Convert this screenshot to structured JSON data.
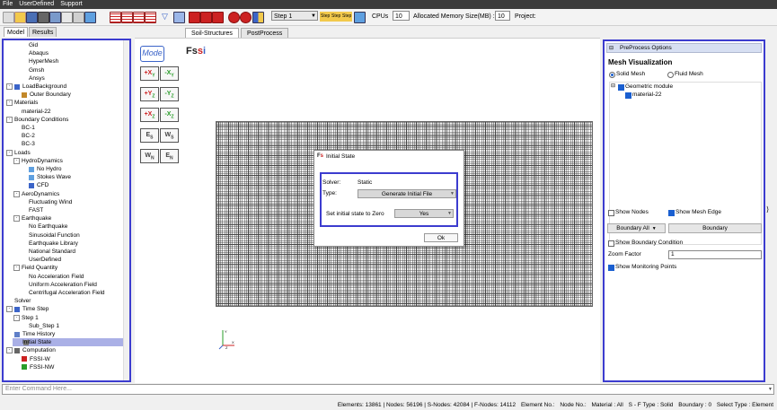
{
  "menu": [
    "File",
    "UserDefined",
    "Support"
  ],
  "toolbar": {
    "step_select": "Step 1",
    "step_buttons": [
      "Step",
      "Step",
      "Step"
    ],
    "cpus_label": "CPUs",
    "cpus_value": "10",
    "memory_label": "Allocated Memory Size(MB) :",
    "memory_value": "10",
    "project_label": "Project:"
  },
  "left_tabs": [
    "Model",
    "Results"
  ],
  "tree": [
    {
      "label": "Gid",
      "level": 2
    },
    {
      "label": "Abaqus",
      "level": 2
    },
    {
      "label": "HyperMesh",
      "level": 2
    },
    {
      "label": "Gmsh",
      "level": 2
    },
    {
      "label": "Ansys",
      "level": 2
    },
    {
      "label": "LoadBackground",
      "level": 0,
      "expander": "⊟",
      "icon": "load-icon"
    },
    {
      "label": "Outer Boundary",
      "level": 1,
      "icon": "boundary-icon"
    },
    {
      "label": "Materials",
      "level": 0,
      "expander": "⊟"
    },
    {
      "label": "material-22",
      "level": 1
    },
    {
      "label": "Boundary Conditions",
      "level": 0,
      "expander": "⊟"
    },
    {
      "label": "BC-1",
      "level": 1
    },
    {
      "label": "BC-2",
      "level": 1
    },
    {
      "label": "BC-3",
      "level": 1
    },
    {
      "label": "Loads",
      "level": 0,
      "expander": "⊟"
    },
    {
      "label": "HydroDynamics",
      "level": 1,
      "expander": "⊟"
    },
    {
      "label": "No Hydro",
      "level": 2,
      "icon": "hydro-icon"
    },
    {
      "label": "Stokes Wave",
      "level": 2,
      "icon": "wave-icon"
    },
    {
      "label": "CFD",
      "level": 2,
      "icon": "cfd-icon"
    },
    {
      "label": "AeroDynamics",
      "level": 1,
      "expander": "⊟"
    },
    {
      "label": "Fluctuating Wind",
      "level": 2
    },
    {
      "label": "FAST",
      "level": 2
    },
    {
      "label": "Earthquake",
      "level": 1,
      "expander": "⊟"
    },
    {
      "label": "No Earthquake",
      "level": 2
    },
    {
      "label": "Sinusoidal Function",
      "level": 2
    },
    {
      "label": "Earthquake Library",
      "level": 2
    },
    {
      "label": "National Standard",
      "level": 2
    },
    {
      "label": "UserDefined",
      "level": 2
    },
    {
      "label": "Field Quantity",
      "level": 1,
      "expander": "⊟"
    },
    {
      "label": "No Acceleration Field",
      "level": 2
    },
    {
      "label": "Uniform Acceleration Field",
      "level": 2
    },
    {
      "label": "Centrifugal Acceleration Field",
      "level": 2
    },
    {
      "label": "Solver",
      "level": 0
    },
    {
      "label": "Time Step",
      "level": 0,
      "expander": "⊟",
      "icon": "clock-icon"
    },
    {
      "label": "Step 1",
      "level": 1,
      "expander": "⊟"
    },
    {
      "label": "Sub_Step 1",
      "level": 2
    },
    {
      "label": "Time History",
      "level": 0,
      "icon": "history-icon"
    },
    {
      "label": "Initial State",
      "level": 0,
      "icon": "initial-state-icon",
      "selected": true
    },
    {
      "label": "Computation",
      "level": 0,
      "expander": "⊟",
      "icon": "computation-icon"
    },
    {
      "label": "FSSI-W",
      "level": 1,
      "icon": "flask-red-icon"
    },
    {
      "label": "FSSI-NW",
      "level": 1,
      "icon": "flask-green-icon"
    }
  ],
  "center_tabs": [
    "Soil-Structures",
    "PostProcess"
  ],
  "mode_button": "Mode",
  "logo_text": "Fssi",
  "side_buttons": [
    {
      "name": "x-plus-y-minus-button",
      "a": "+X",
      "b": "Y"
    },
    {
      "name": "x-minus-y-minus-button",
      "a": "-X",
      "b": "Y"
    },
    {
      "name": "y-plus-z-button",
      "a": "+Y",
      "b": "Z"
    },
    {
      "name": "y-minus-z-button",
      "a": "-Y",
      "b": "Z"
    },
    {
      "name": "x-plus-z-button",
      "a": "+X",
      "b": "Z"
    },
    {
      "name": "x-minus-z-button",
      "a": "-X",
      "b": "Z"
    },
    {
      "name": "e-s-button",
      "a": "E",
      "b": "S"
    },
    {
      "name": "w-s-button",
      "a": "W",
      "b": "S"
    },
    {
      "name": "w-n-button",
      "a": "W",
      "b": "N"
    },
    {
      "name": "e-n-button",
      "a": "E",
      "b": "N"
    }
  ],
  "axes": {
    "x": "X",
    "y": "Y",
    "z": "Z"
  },
  "dialog": {
    "title": "Initial State",
    "solver_label": "Solver:",
    "solver_value": "Static",
    "type_label": "Type:",
    "type_value": "Generate Initial File",
    "zero_label": "Set initial state to Zero",
    "zero_value": "Yes",
    "ok": "Ok"
  },
  "right_panel": {
    "header": "PreProcess Options",
    "title": "Mesh Visualization",
    "solid_mesh": "Solid Mesh",
    "fluid_mesh": "Fluid Mesh",
    "geometric_module": "Geometric module",
    "material": "material-22",
    "show_nodes": "Show Nodes",
    "show_mesh_edge": "Show Mesh Edge",
    "boundary_all": "Boundary All",
    "boundary": "Boundary",
    "show_boundary_condition": "Show Boundary Condition",
    "zoom_factor_label": "Zoom Factor",
    "zoom_factor_value": "1",
    "show_monitoring_points": "Show Monitoring Points"
  },
  "command_placeholder": "Enter Command Here...",
  "status": [
    "Elements: 13861 | Nodes: 56196 | S-Nodes: 42084 | F-Nodes: 14112",
    "Element No.:",
    "Node No.:",
    "Material : All",
    "S - F Type : Solid",
    "Boundary : 0",
    "Select Type : Element"
  ]
}
